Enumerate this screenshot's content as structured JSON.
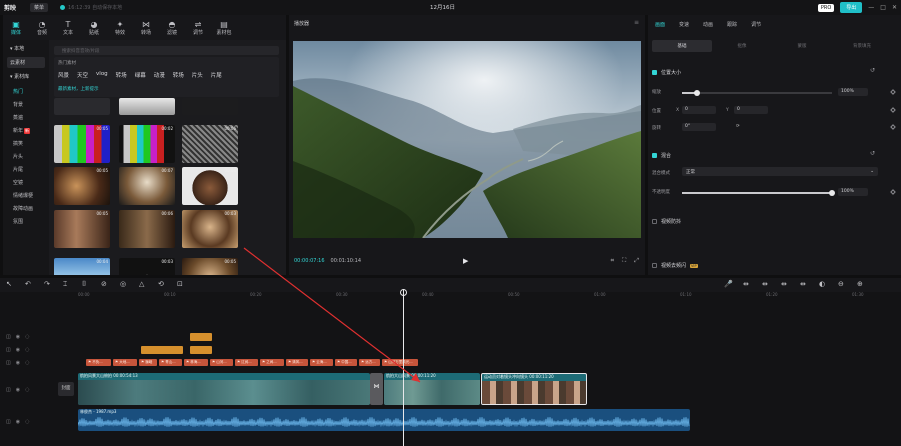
{
  "app": {
    "logo_label": "剪映",
    "menu_label": "菜单",
    "save_status": "16:12:39 自动保存本地",
    "project_title": "12月16日",
    "pro_label": "PRO",
    "export_label": "导出",
    "window_controls": [
      "—",
      "□",
      "✕"
    ]
  },
  "toolbar": [
    {
      "icon": "media-icon",
      "glyph": "▣",
      "label": "媒体",
      "active": true
    },
    {
      "icon": "audio-icon",
      "glyph": "◔",
      "label": "音频",
      "active": false
    },
    {
      "icon": "text-icon",
      "glyph": "T",
      "label": "文本",
      "active": false
    },
    {
      "icon": "sticker-icon",
      "glyph": "◕",
      "label": "贴纸",
      "active": false
    },
    {
      "icon": "effects-icon",
      "glyph": "✦",
      "label": "特效",
      "active": false
    },
    {
      "icon": "transition-icon",
      "glyph": "⋈",
      "label": "转场",
      "active": false
    },
    {
      "icon": "filter-icon",
      "glyph": "◓",
      "label": "滤镜",
      "active": false
    },
    {
      "icon": "adjust-icon",
      "glyph": "⇌",
      "label": "调节",
      "active": false
    },
    {
      "icon": "template-icon",
      "glyph": "▤",
      "label": "素材包",
      "active": false
    }
  ],
  "leftnav": {
    "local_label": "▾ 本地",
    "cloud_label": "云素材",
    "library_label": "▾ 素材库",
    "items": [
      {
        "label": "热门",
        "active": true,
        "hot": false
      },
      {
        "label": "背景",
        "active": false,
        "hot": false
      },
      {
        "label": "蒸遍",
        "active": false,
        "hot": false
      },
      {
        "label": "新年",
        "active": false,
        "hot": true
      },
      {
        "label": "搞笑",
        "active": false,
        "hot": false
      },
      {
        "label": "片头",
        "active": false,
        "hot": false
      },
      {
        "label": "片尾",
        "active": false,
        "hot": false
      },
      {
        "label": "空镜",
        "active": false,
        "hot": false
      },
      {
        "label": "情绪爆梗",
        "active": false,
        "hot": false
      },
      {
        "label": "故障动画",
        "active": false,
        "hot": false
      },
      {
        "label": "氛围",
        "active": false,
        "hot": false
      }
    ],
    "hot_badge": "新"
  },
  "media": {
    "search_placeholder": "搜索抖音音效/片段",
    "hot_title": "热门素材",
    "tags": [
      "风景",
      "天空",
      "vlog",
      "转场",
      "绿幕",
      "动漫",
      "转场",
      "片头",
      "片尾"
    ],
    "hint": "最新素材，上新提示",
    "durations": [
      "00:05",
      "00:02",
      "00:06",
      "00:05",
      "00:07",
      "00:04",
      "00:05",
      "00:06",
      "00:03",
      "00:04",
      "00:03",
      "00:05"
    ]
  },
  "player": {
    "title": "播放器",
    "current_time": "00:00:07:16",
    "total_time": "00:01:10:14",
    "controls": [
      "⌗",
      "⛶",
      "⤢"
    ]
  },
  "props": {
    "tabs": [
      "画面",
      "变速",
      "动画",
      "跟踪",
      "调节"
    ],
    "subtabs": [
      "基础",
      "抠像",
      "蒙版",
      "背景填充"
    ],
    "position_size_label": "位置大小",
    "scale_label": "缩放",
    "scale_value": "100%",
    "scale_level": 0.1,
    "position_label": "位置",
    "pos_x_label": "X",
    "pos_x": "0",
    "pos_y_label": "Y",
    "pos_y": "0",
    "rotate_label": "旋转",
    "rotate_value": "0°",
    "blend_label": "混合",
    "blend_mode_label": "混合模式",
    "blend_mode_value": "正常",
    "opacity_label": "不透明度",
    "opacity_value": "100%",
    "opacity_level": 1.0,
    "stabilize_label": "视频防抖",
    "denoise_label": "视频去频闪",
    "vip_badge": "VIP"
  },
  "timeline": {
    "tools": [
      "↖",
      "↶",
      "↷",
      "⌶",
      "⌷",
      "⊘",
      "◎",
      "△",
      "⟲",
      "⊡"
    ],
    "right_tools": [
      "🎤",
      "⇹",
      "⇹",
      "⇹",
      "⇹",
      "◐",
      "⊖",
      "⊕"
    ],
    "ticks": [
      "00:00",
      "00:10",
      "00:20",
      "00:30",
      "00:40",
      "00:50",
      "01:00",
      "01:10",
      "01:20",
      "01:30"
    ],
    "cover_label": "封面",
    "main_clips": [
      {
        "label": "航拍风景大山俯拍 00:00:54:13"
      },
      {
        "label": "航拍大山风景 00:00:11:20"
      },
      {
        "label": "运动员对着镜头冲向镜头 00:00:11:20"
      }
    ],
    "audio_label": "林俊杰 - 1987.mp3",
    "subtitles": [
      "⚑ 不负...",
      "⚑ 大地...",
      "⚑ 巍峨",
      "⚑ 青山...",
      "⚑ 林海...",
      "⚑ 山河...",
      "⚑ 辽阔...",
      "⚑ 之间...",
      "⚑ 清风...",
      "⚑ 云海...",
      "⚑ 中国...",
      "⚑ 远方...",
      "⚑ 山河万里风光..."
    ]
  }
}
